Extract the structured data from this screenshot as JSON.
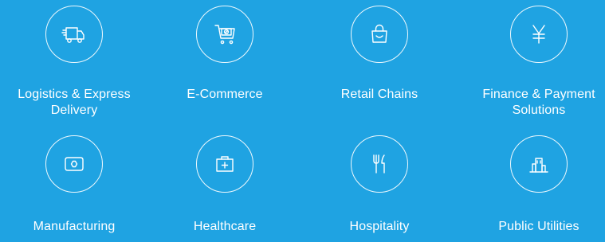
{
  "industries": [
    {
      "label": "Logistics & Express Delivery",
      "icon": "delivery-truck-icon"
    },
    {
      "label": "E-Commerce",
      "icon": "shopping-cart-icon"
    },
    {
      "label": "Retail Chains",
      "icon": "shopping-bag-icon"
    },
    {
      "label": "Finance & Payment Solutions",
      "icon": "yen-icon"
    },
    {
      "label": "Manufacturing",
      "icon": "hex-nut-icon"
    },
    {
      "label": "Healthcare",
      "icon": "medical-kit-icon"
    },
    {
      "label": "Hospitality",
      "icon": "fork-knife-icon"
    },
    {
      "label": "Public Utilities",
      "icon": "building-icon"
    }
  ],
  "colors": {
    "background": "#1fa3e2",
    "foreground": "#ffffff"
  }
}
